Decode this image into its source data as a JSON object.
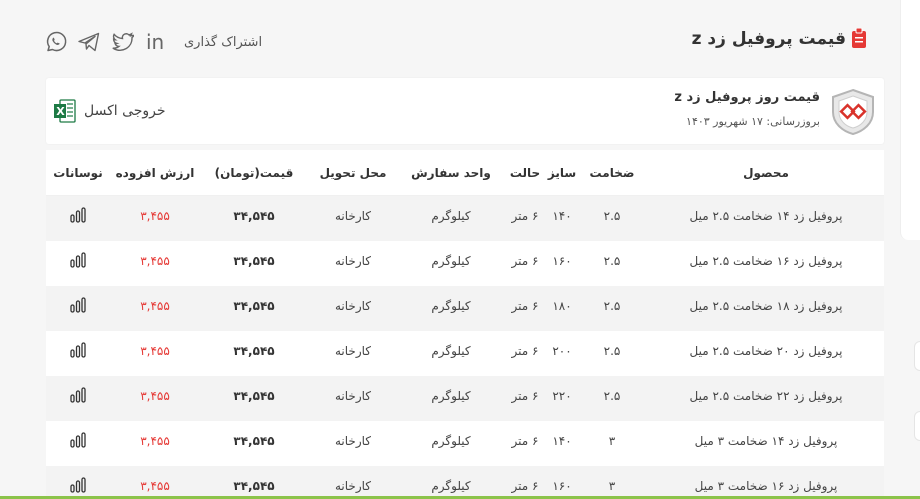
{
  "header": {
    "title": "قیمت پروفیل زد z",
    "share_label": "اشتراک گذاری",
    "social": [
      {
        "name": "linkedin-icon",
        "text": "in"
      },
      {
        "name": "twitter-icon",
        "text": ""
      },
      {
        "name": "telegram-icon",
        "text": ""
      },
      {
        "name": "whatsapp-icon",
        "text": ""
      }
    ]
  },
  "product_card": {
    "title": "قیمت روز پروفیل زد z",
    "updated": "بروزرسانی: ۱۷ شهریور ۱۴۰۳",
    "excel_label": "خروجی اکسل"
  },
  "table": {
    "columns": [
      "محصول",
      "ضخامت",
      "سایز",
      "حالت",
      "واحد سفارش",
      "محل تحویل",
      "قیمت(تومان)",
      "ارزش افزوده",
      "نوسانات"
    ],
    "rows": [
      {
        "product": "پروفیل زد ۱۴ ضخامت ۲.۵ میل",
        "thickness": "۲.۵",
        "size": "۱۴۰",
        "state": "۶ متر",
        "unit": "کیلوگرم",
        "delivery": "کارخانه",
        "price": "۳۴,۵۴۵",
        "vat": "۳,۴۵۵"
      },
      {
        "product": "پروفیل زد ۱۶ ضخامت ۲.۵ میل",
        "thickness": "۲.۵",
        "size": "۱۶۰",
        "state": "۶ متر",
        "unit": "کیلوگرم",
        "delivery": "کارخانه",
        "price": "۳۴,۵۴۵",
        "vat": "۳,۴۵۵"
      },
      {
        "product": "پروفیل زد ۱۸ ضخامت ۲.۵ میل",
        "thickness": "۲.۵",
        "size": "۱۸۰",
        "state": "۶ متر",
        "unit": "کیلوگرم",
        "delivery": "کارخانه",
        "price": "۳۴,۵۴۵",
        "vat": "۳,۴۵۵"
      },
      {
        "product": "پروفیل زد ۲۰ ضخامت ۲.۵ میل",
        "thickness": "۲.۵",
        "size": "۲۰۰",
        "state": "۶ متر",
        "unit": "کیلوگرم",
        "delivery": "کارخانه",
        "price": "۳۴,۵۴۵",
        "vat": "۳,۴۵۵"
      },
      {
        "product": "پروفیل زد ۲۲ ضخامت ۲.۵ میل",
        "thickness": "۲.۵",
        "size": "۲۲۰",
        "state": "۶ متر",
        "unit": "کیلوگرم",
        "delivery": "کارخانه",
        "price": "۳۴,۵۴۵",
        "vat": "۳,۴۵۵"
      },
      {
        "product": "پروفیل زد ۱۴ ضخامت ۳ میل",
        "thickness": "۳",
        "size": "۱۴۰",
        "state": "۶ متر",
        "unit": "کیلوگرم",
        "delivery": "کارخانه",
        "price": "۳۴,۵۴۵",
        "vat": "۳,۴۵۵"
      },
      {
        "product": "پروفیل زد ۱۶ ضخامت ۳ میل",
        "thickness": "۳",
        "size": "۱۶۰",
        "state": "۶ متر",
        "unit": "کیلوگرم",
        "delivery": "کارخانه",
        "price": "۳۴,۵۴۵",
        "vat": "۳,۴۵۵"
      }
    ]
  },
  "colors": {
    "accent": "#e53935",
    "excel": "#1d7a45",
    "brand": "#d9332b",
    "bottom_bar": "#8bc34a"
  }
}
